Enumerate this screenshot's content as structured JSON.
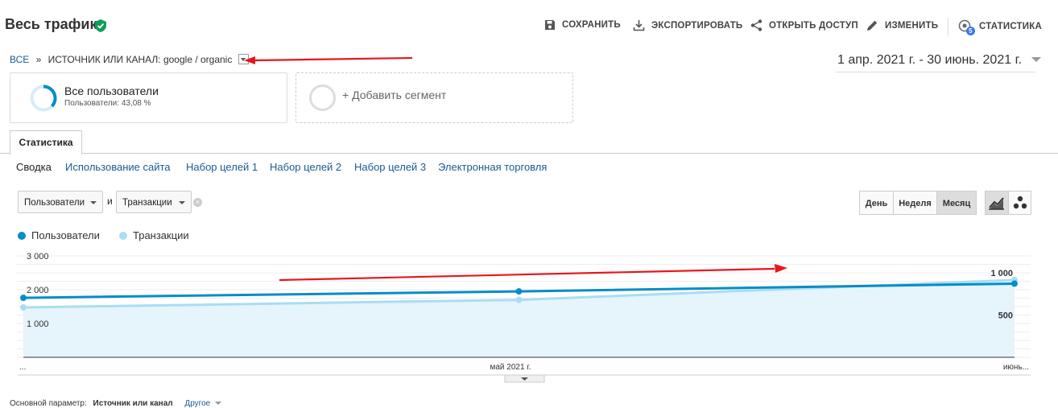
{
  "header": {
    "title": "Весь трафик",
    "toolbar": [
      {
        "label": "СОХРАНИТЬ",
        "icon": "save-icon"
      },
      {
        "label": "ЭКСПОРТИРОВАТЬ",
        "icon": "download-icon"
      },
      {
        "label": "ОТКРЫТЬ ДОСТУП",
        "icon": "share-icon"
      },
      {
        "label": "ИЗМЕНИТЬ",
        "icon": "pencil-icon"
      },
      {
        "label": "СТАТИСТИКА",
        "icon": "insights-icon",
        "badge": "5"
      }
    ]
  },
  "breadcrumb": {
    "root": "ВСЕ",
    "sep": "»",
    "current": "ИСТОЧНИК ИЛИ КАНАЛ: google / organic"
  },
  "date_range": "1 апр. 2021 г. - 30 июнь. 2021 г.",
  "segments": {
    "active": {
      "name": "Все пользователи",
      "detail": "Пользователи: 43,08 %"
    },
    "add_label": "+ Добавить сегмент"
  },
  "tabs": {
    "active": "Статистика"
  },
  "subnav": [
    "Сводка",
    "Использование сайта",
    "Набор целей 1",
    "Набор целей 2",
    "Набор целей 3",
    "Электронная торговля"
  ],
  "metric_selectors": {
    "primary": "Пользователи",
    "joiner": "и",
    "secondary": "Транзакции"
  },
  "granularity": [
    "День",
    "Неделя",
    "Месяц"
  ],
  "granularity_selected": "Месяц",
  "colors": {
    "accent": "#058dc7",
    "secondary_series": "#a9ddf3",
    "link": "#1a5a96",
    "verified": "#0f9d58",
    "annotation": "#e8161b"
  },
  "chart_data": {
    "type": "line",
    "x": [
      "апр. 2021 г.",
      "май 2021 г.",
      "июнь 2021 г."
    ],
    "x_tick_labels": [
      "...",
      "май 2021 г.",
      "июнь..."
    ],
    "series": [
      {
        "name": "Пользователи",
        "values": [
          1760,
          1950,
          2180
        ],
        "axis": "left"
      },
      {
        "name": "Транзакции",
        "values": [
          590,
          680,
          915
        ],
        "axis": "right"
      }
    ],
    "left_axis": {
      "ticks": [
        "1 000",
        "2 000",
        "3 000"
      ],
      "range": [
        0,
        3000
      ]
    },
    "right_axis": {
      "ticks": [
        "500",
        "1 000"
      ],
      "range": [
        0,
        1200
      ]
    },
    "legend": "top-left",
    "grid": true
  },
  "footer": {
    "primary_label": "Основной параметр:",
    "primary_value": "Источник или канал",
    "other": "Другое"
  }
}
